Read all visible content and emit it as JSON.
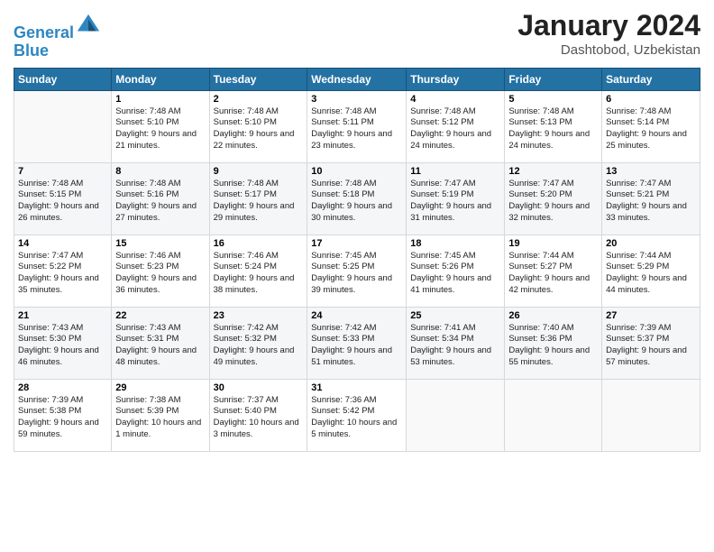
{
  "header": {
    "logo_line1": "General",
    "logo_line2": "Blue",
    "month": "January 2024",
    "location": "Dashtobod, Uzbekistan"
  },
  "days_of_week": [
    "Sunday",
    "Monday",
    "Tuesday",
    "Wednesday",
    "Thursday",
    "Friday",
    "Saturday"
  ],
  "weeks": [
    [
      {
        "day": "",
        "sunrise": "",
        "sunset": "",
        "daylight": ""
      },
      {
        "day": "1",
        "sunrise": "Sunrise: 7:48 AM",
        "sunset": "Sunset: 5:10 PM",
        "daylight": "Daylight: 9 hours and 21 minutes."
      },
      {
        "day": "2",
        "sunrise": "Sunrise: 7:48 AM",
        "sunset": "Sunset: 5:10 PM",
        "daylight": "Daylight: 9 hours and 22 minutes."
      },
      {
        "day": "3",
        "sunrise": "Sunrise: 7:48 AM",
        "sunset": "Sunset: 5:11 PM",
        "daylight": "Daylight: 9 hours and 23 minutes."
      },
      {
        "day": "4",
        "sunrise": "Sunrise: 7:48 AM",
        "sunset": "Sunset: 5:12 PM",
        "daylight": "Daylight: 9 hours and 24 minutes."
      },
      {
        "day": "5",
        "sunrise": "Sunrise: 7:48 AM",
        "sunset": "Sunset: 5:13 PM",
        "daylight": "Daylight: 9 hours and 24 minutes."
      },
      {
        "day": "6",
        "sunrise": "Sunrise: 7:48 AM",
        "sunset": "Sunset: 5:14 PM",
        "daylight": "Daylight: 9 hours and 25 minutes."
      }
    ],
    [
      {
        "day": "7",
        "sunrise": "Sunrise: 7:48 AM",
        "sunset": "Sunset: 5:15 PM",
        "daylight": "Daylight: 9 hours and 26 minutes."
      },
      {
        "day": "8",
        "sunrise": "Sunrise: 7:48 AM",
        "sunset": "Sunset: 5:16 PM",
        "daylight": "Daylight: 9 hours and 27 minutes."
      },
      {
        "day": "9",
        "sunrise": "Sunrise: 7:48 AM",
        "sunset": "Sunset: 5:17 PM",
        "daylight": "Daylight: 9 hours and 29 minutes."
      },
      {
        "day": "10",
        "sunrise": "Sunrise: 7:48 AM",
        "sunset": "Sunset: 5:18 PM",
        "daylight": "Daylight: 9 hours and 30 minutes."
      },
      {
        "day": "11",
        "sunrise": "Sunrise: 7:47 AM",
        "sunset": "Sunset: 5:19 PM",
        "daylight": "Daylight: 9 hours and 31 minutes."
      },
      {
        "day": "12",
        "sunrise": "Sunrise: 7:47 AM",
        "sunset": "Sunset: 5:20 PM",
        "daylight": "Daylight: 9 hours and 32 minutes."
      },
      {
        "day": "13",
        "sunrise": "Sunrise: 7:47 AM",
        "sunset": "Sunset: 5:21 PM",
        "daylight": "Daylight: 9 hours and 33 minutes."
      }
    ],
    [
      {
        "day": "14",
        "sunrise": "Sunrise: 7:47 AM",
        "sunset": "Sunset: 5:22 PM",
        "daylight": "Daylight: 9 hours and 35 minutes."
      },
      {
        "day": "15",
        "sunrise": "Sunrise: 7:46 AM",
        "sunset": "Sunset: 5:23 PM",
        "daylight": "Daylight: 9 hours and 36 minutes."
      },
      {
        "day": "16",
        "sunrise": "Sunrise: 7:46 AM",
        "sunset": "Sunset: 5:24 PM",
        "daylight": "Daylight: 9 hours and 38 minutes."
      },
      {
        "day": "17",
        "sunrise": "Sunrise: 7:45 AM",
        "sunset": "Sunset: 5:25 PM",
        "daylight": "Daylight: 9 hours and 39 minutes."
      },
      {
        "day": "18",
        "sunrise": "Sunrise: 7:45 AM",
        "sunset": "Sunset: 5:26 PM",
        "daylight": "Daylight: 9 hours and 41 minutes."
      },
      {
        "day": "19",
        "sunrise": "Sunrise: 7:44 AM",
        "sunset": "Sunset: 5:27 PM",
        "daylight": "Daylight: 9 hours and 42 minutes."
      },
      {
        "day": "20",
        "sunrise": "Sunrise: 7:44 AM",
        "sunset": "Sunset: 5:29 PM",
        "daylight": "Daylight: 9 hours and 44 minutes."
      }
    ],
    [
      {
        "day": "21",
        "sunrise": "Sunrise: 7:43 AM",
        "sunset": "Sunset: 5:30 PM",
        "daylight": "Daylight: 9 hours and 46 minutes."
      },
      {
        "day": "22",
        "sunrise": "Sunrise: 7:43 AM",
        "sunset": "Sunset: 5:31 PM",
        "daylight": "Daylight: 9 hours and 48 minutes."
      },
      {
        "day": "23",
        "sunrise": "Sunrise: 7:42 AM",
        "sunset": "Sunset: 5:32 PM",
        "daylight": "Daylight: 9 hours and 49 minutes."
      },
      {
        "day": "24",
        "sunrise": "Sunrise: 7:42 AM",
        "sunset": "Sunset: 5:33 PM",
        "daylight": "Daylight: 9 hours and 51 minutes."
      },
      {
        "day": "25",
        "sunrise": "Sunrise: 7:41 AM",
        "sunset": "Sunset: 5:34 PM",
        "daylight": "Daylight: 9 hours and 53 minutes."
      },
      {
        "day": "26",
        "sunrise": "Sunrise: 7:40 AM",
        "sunset": "Sunset: 5:36 PM",
        "daylight": "Daylight: 9 hours and 55 minutes."
      },
      {
        "day": "27",
        "sunrise": "Sunrise: 7:39 AM",
        "sunset": "Sunset: 5:37 PM",
        "daylight": "Daylight: 9 hours and 57 minutes."
      }
    ],
    [
      {
        "day": "28",
        "sunrise": "Sunrise: 7:39 AM",
        "sunset": "Sunset: 5:38 PM",
        "daylight": "Daylight: 9 hours and 59 minutes."
      },
      {
        "day": "29",
        "sunrise": "Sunrise: 7:38 AM",
        "sunset": "Sunset: 5:39 PM",
        "daylight": "Daylight: 10 hours and 1 minute."
      },
      {
        "day": "30",
        "sunrise": "Sunrise: 7:37 AM",
        "sunset": "Sunset: 5:40 PM",
        "daylight": "Daylight: 10 hours and 3 minutes."
      },
      {
        "day": "31",
        "sunrise": "Sunrise: 7:36 AM",
        "sunset": "Sunset: 5:42 PM",
        "daylight": "Daylight: 10 hours and 5 minutes."
      },
      {
        "day": "",
        "sunrise": "",
        "sunset": "",
        "daylight": ""
      },
      {
        "day": "",
        "sunrise": "",
        "sunset": "",
        "daylight": ""
      },
      {
        "day": "",
        "sunrise": "",
        "sunset": "",
        "daylight": ""
      }
    ]
  ]
}
